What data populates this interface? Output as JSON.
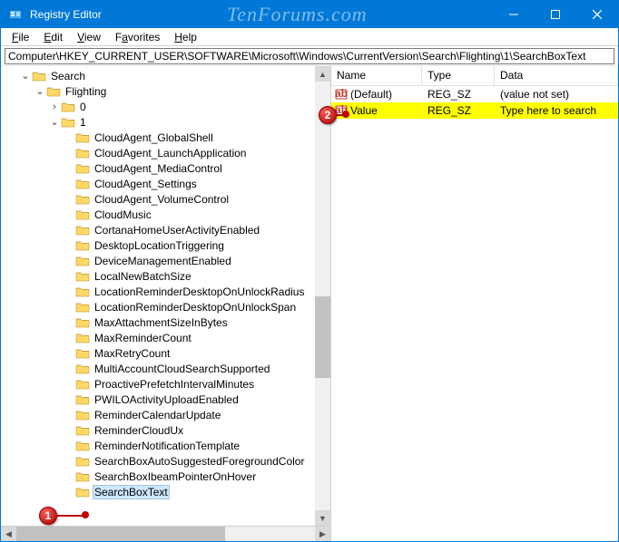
{
  "window": {
    "title": "Registry Editor",
    "watermark": "TenForums.com"
  },
  "menu": {
    "file": "File",
    "edit": "Edit",
    "view": "View",
    "favorites": "Favorites",
    "help": "Help"
  },
  "address": {
    "path": "Computer\\HKEY_CURRENT_USER\\SOFTWARE\\Microsoft\\Windows\\CurrentVersion\\Search\\Flighting\\1\\SearchBoxText"
  },
  "tree": {
    "root1": "Search",
    "root2": "Flighting",
    "node0": "0",
    "node1": "1",
    "items": [
      "CloudAgent_GlobalShell",
      "CloudAgent_LaunchApplication",
      "CloudAgent_MediaControl",
      "CloudAgent_Settings",
      "CloudAgent_VolumeControl",
      "CloudMusic",
      "CortanaHomeUserActivityEnabled",
      "DesktopLocationTriggering",
      "DeviceManagementEnabled",
      "LocalNewBatchSize",
      "LocationReminderDesktopOnUnlockRadius",
      "LocationReminderDesktopOnUnlockSpan",
      "MaxAttachmentSizeInBytes",
      "MaxReminderCount",
      "MaxRetryCount",
      "MultiAccountCloudSearchSupported",
      "ProactivePrefetchIntervalMinutes",
      "PWILOActivityUploadEnabled",
      "ReminderCalendarUpdate",
      "ReminderCloudUx",
      "ReminderNotificationTemplate",
      "SearchBoxAutoSuggestedForegroundColor",
      "SearchBoxIbeamPointerOnHover"
    ],
    "selected": "SearchBoxText"
  },
  "values": {
    "headers": {
      "name": "Name",
      "type": "Type",
      "data": "Data"
    },
    "rows": [
      {
        "name": "(Default)",
        "type": "REG_SZ",
        "data": "(value not set)",
        "highlight": false
      },
      {
        "name": "Value",
        "type": "REG_SZ",
        "data": "Type here to search",
        "highlight": true
      }
    ]
  },
  "callouts": {
    "one": "1",
    "two": "2"
  }
}
